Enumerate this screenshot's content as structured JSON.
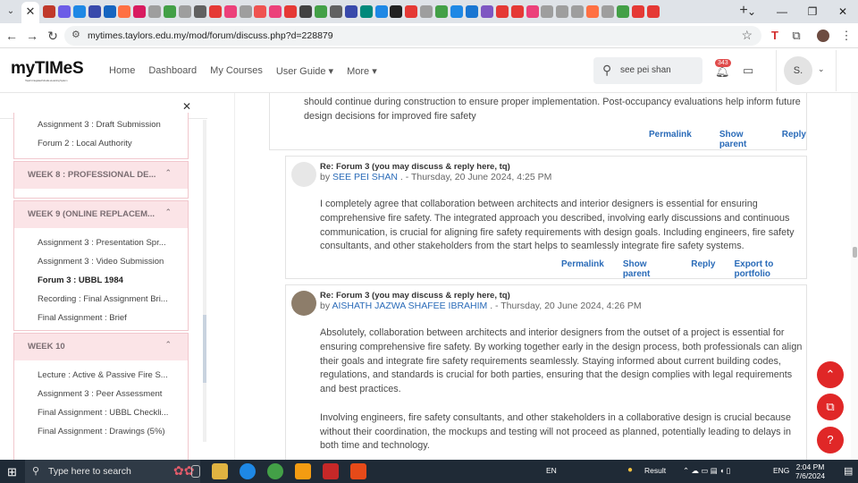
{
  "browser": {
    "url": "mytimes.taylors.edu.my/mod/forum/discuss.php?d=228879",
    "active_tab_close": "✕",
    "new_tab": "+",
    "window_controls": [
      "⌄",
      "—",
      "❐",
      "✕"
    ]
  },
  "site": {
    "logo": "myTIMeS",
    "logo_tagline": "Taylor's Integrated Moodle eLearning System",
    "nav": [
      {
        "label": "Home"
      },
      {
        "label": "Dashboard"
      },
      {
        "label": "My Courses"
      },
      {
        "label": "User Guide ▾"
      },
      {
        "label": "More ▾"
      }
    ],
    "search_value": "see pei shan",
    "notification_count": "343",
    "avatar_initial": "S."
  },
  "drawer": {
    "top_items": [
      "Assignment 3 : Draft Submission",
      "Forum 2 : Local Authority"
    ],
    "sections": [
      {
        "title": "WEEK 8 : PROFESSIONAL DE...",
        "items": []
      },
      {
        "title": "WEEK 9 (ONLINE REPLACEM...",
        "items": [
          "Assignment 3 : Presentation Spr...",
          "Assignment 3 : Video Submission",
          "Forum 3 : UBBL 1984",
          "Recording : Final Assignment Bri...",
          "Final Assignment : Brief"
        ]
      },
      {
        "title": "WEEK 10",
        "items": [
          "Lecture : Active & Passive Fire S...",
          "Assignment 3 : Peer Assessment",
          "Final Assignment : UBBL Checkli...",
          "Final Assignment : Drawings (5%)"
        ]
      }
    ]
  },
  "posts": {
    "prev": {
      "body_l1": "should continue during construction to ensure proper implementation. Post-occupancy evaluations help inform future",
      "body_l2": "design decisions for improved fire safety",
      "actions": [
        "Permalink",
        "Show parent",
        "Reply"
      ]
    },
    "p1": {
      "subject": "Re: Forum 3 (you may discuss & reply here, tq)",
      "by": "by",
      "author": "SEE PEI SHAN",
      "date": " . - Thursday, 20 June 2024, 4:25 PM",
      "lines": [
        "I completely agree that collaboration between architects and interior designers is essential for ensuring",
        "comprehensive fire safety. The integrated approach you described, involving early discussions and continuous",
        "communication, is crucial for aligning fire safety requirements with design goals. Including engineers, fire safety",
        "consultants, and other stakeholders from the start helps to seamlessly integrate fire safety systems."
      ],
      "actions": [
        "Permalink",
        "Show parent",
        "Reply",
        "Export to portfolio"
      ]
    },
    "p2": {
      "subject": "Re: Forum 3 (you may discuss & reply here, tq)",
      "by": "by",
      "author": "AISHATH JAZWA SHAFEE IBRAHIM",
      "date": " . - Thursday, 20 June 2024, 4:26 PM",
      "lines": [
        "Absolutely, collaboration between architects and interior designers from the outset of a project is essential for",
        "ensuring comprehensive fire safety. By working together early in the design process, both professionals can align",
        "their goals and integrate fire safety requirements seamlessly. Staying informed about current building codes,",
        "regulations, and standards is crucial for both parties, ensuring that the design complies with legal requirements",
        "and best practices."
      ],
      "lines2": [
        "Involving engineers, fire safety consultants, and other stakeholders in a collaborative design is crucial because",
        "without their coordination, the mockups and testing will not proceed as planned, potentially leading to delays in",
        "both time and technology."
      ]
    }
  },
  "taskbar": {
    "search_placeholder": "Type here to search",
    "lang_indicator": "EN",
    "weather": "Result",
    "keyboard": "ENG",
    "time": "2:04 PM",
    "date": "7/6/2024"
  },
  "colors": {
    "accent_red": "#e02727",
    "link_blue": "#2a6bb8",
    "section_pink": "#fbe4e7"
  }
}
